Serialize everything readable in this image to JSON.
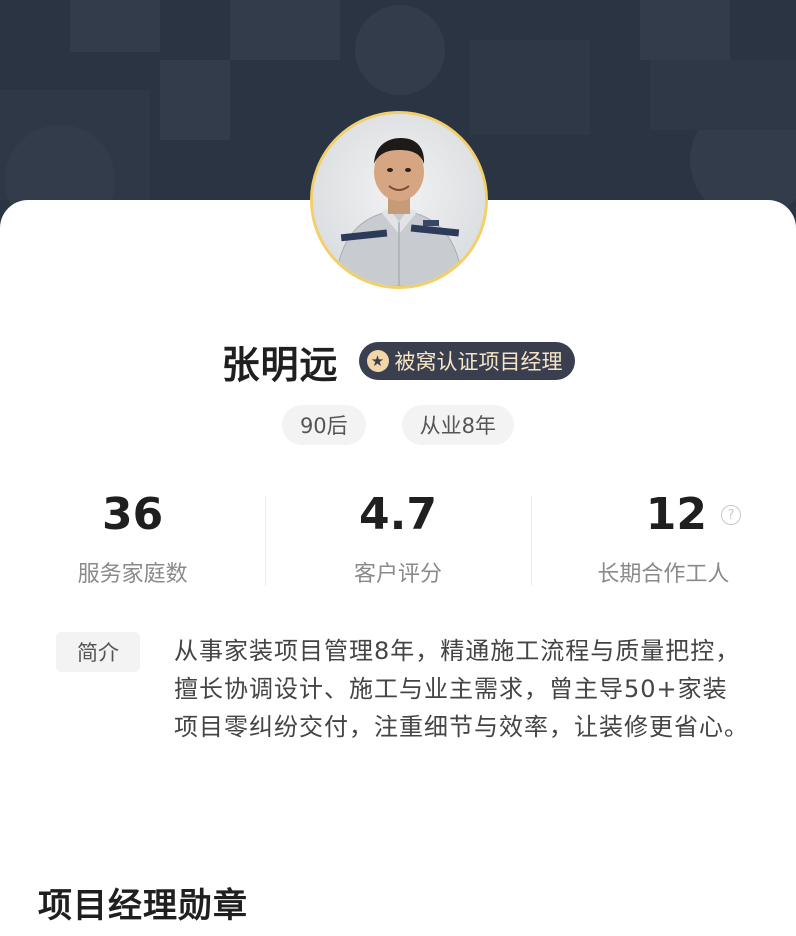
{
  "profile": {
    "name": "张明远",
    "cert_badge": "被窝认证项目经理",
    "cert_icon": "star-icon",
    "tags": [
      "90后",
      "从业8年"
    ]
  },
  "stats": [
    {
      "value": "36",
      "label": "服务家庭数"
    },
    {
      "value": "4.7",
      "label": "客户评分"
    },
    {
      "value": "12",
      "label": "长期合作工人",
      "help_icon": "question-icon"
    }
  ],
  "intro": {
    "label": "简介",
    "text": "从事家装项目管理8年，精通施工流程与质量把控，擅长协调设计、施工与业主需求，曾主导50+家装项目零纠纷交付，注重细节与效率，让装修更省心。"
  },
  "section": {
    "title": "项目经理勋章"
  },
  "colors": {
    "hero_bg": "#2b3442",
    "badge_bg": "#3a3f50",
    "badge_text": "#f6e4c4",
    "avatar_border": "#f3cf6a"
  }
}
